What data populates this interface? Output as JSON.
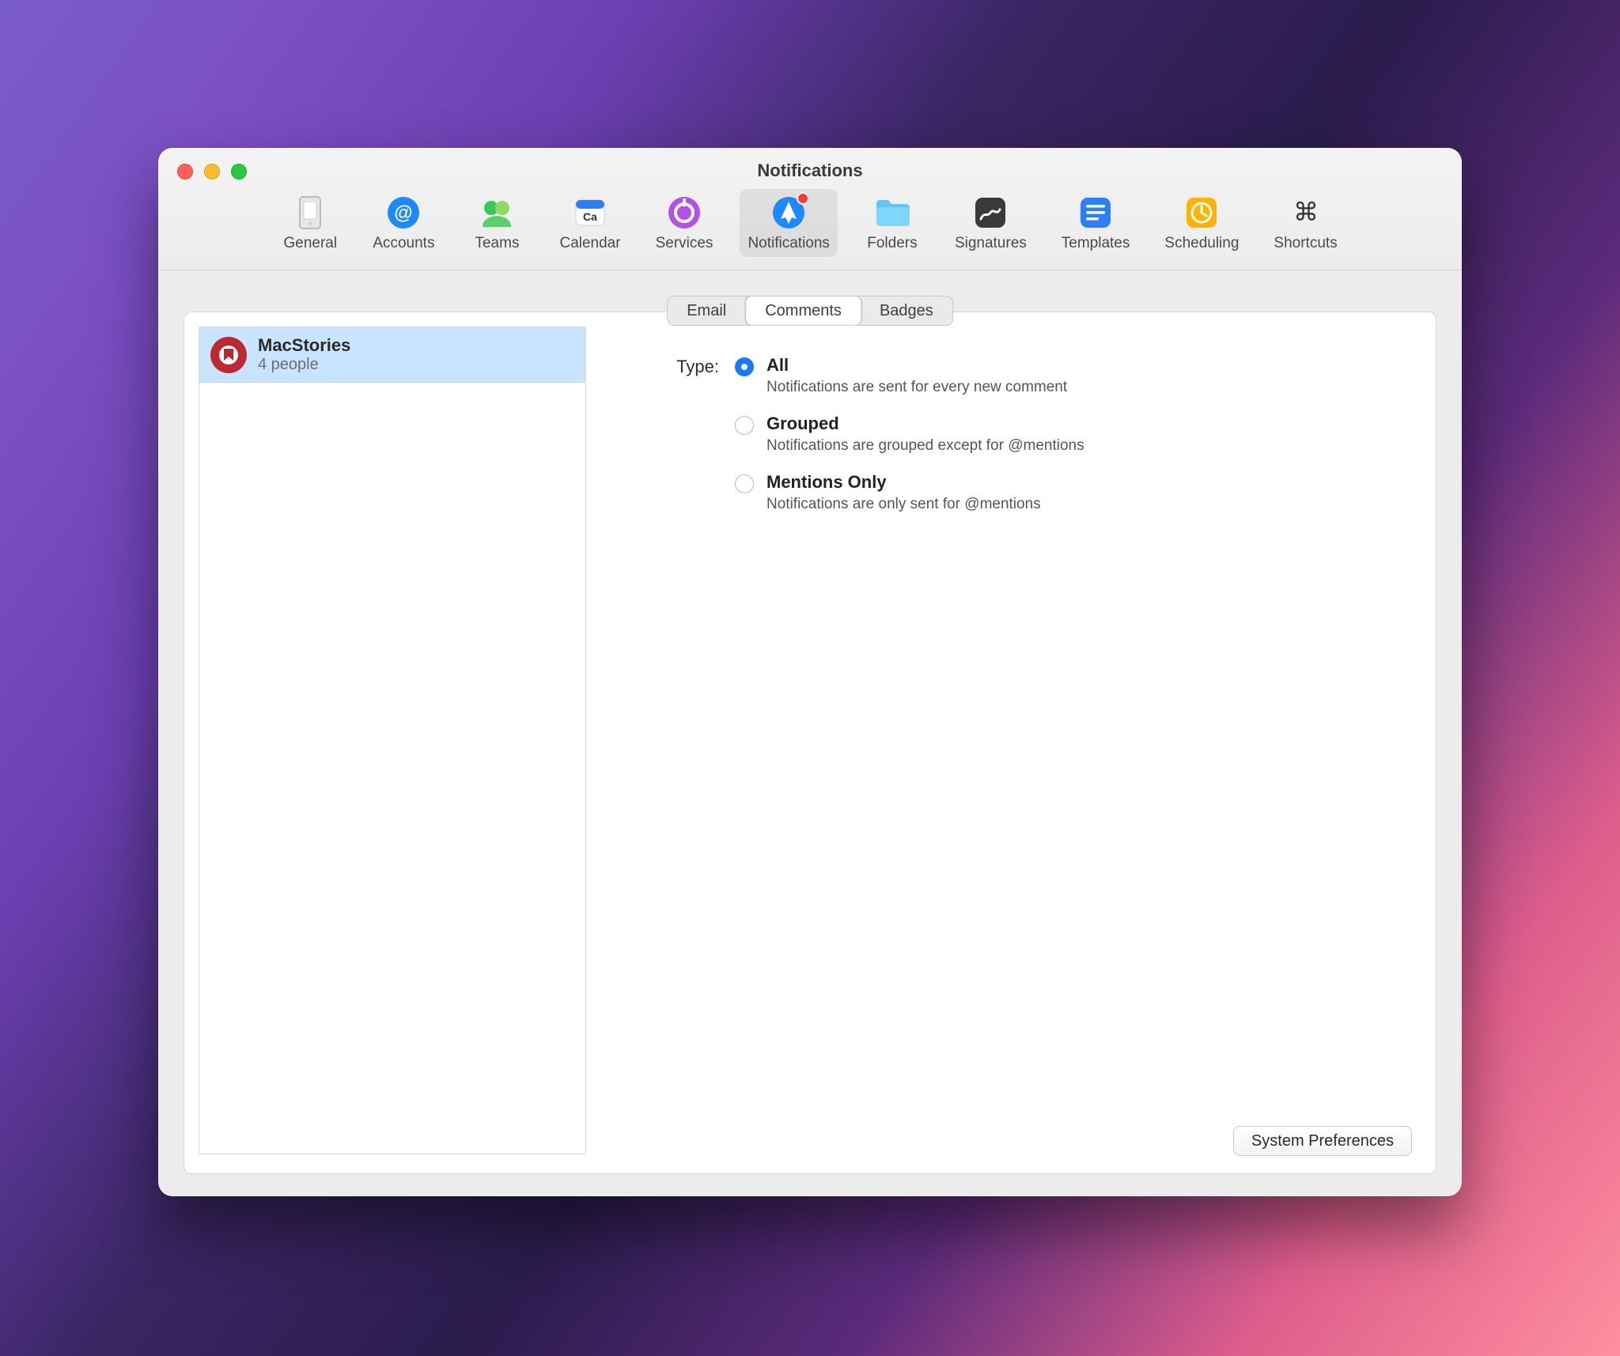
{
  "window_title": "Notifications",
  "toolbar": {
    "items": [
      {
        "id": "general",
        "label": "General"
      },
      {
        "id": "accounts",
        "label": "Accounts"
      },
      {
        "id": "teams",
        "label": "Teams"
      },
      {
        "id": "calendar",
        "label": "Calendar"
      },
      {
        "id": "services",
        "label": "Services"
      },
      {
        "id": "notifications",
        "label": "Notifications",
        "selected": true,
        "badge": true
      },
      {
        "id": "folders",
        "label": "Folders"
      },
      {
        "id": "signatures",
        "label": "Signatures"
      },
      {
        "id": "templates",
        "label": "Templates"
      },
      {
        "id": "scheduling",
        "label": "Scheduling"
      },
      {
        "id": "shortcuts",
        "label": "Shortcuts"
      }
    ]
  },
  "tabs": [
    {
      "label": "Email"
    },
    {
      "label": "Comments",
      "selected": true
    },
    {
      "label": "Badges"
    }
  ],
  "team_list": [
    {
      "name": "MacStories",
      "subtitle": "4 people",
      "selected": true
    }
  ],
  "type_section": {
    "label": "Type:",
    "options": [
      {
        "id": "all",
        "title": "All",
        "desc": "Notifications are sent for every new comment",
        "checked": true
      },
      {
        "id": "grouped",
        "title": "Grouped",
        "desc": "Notifications are grouped except for @mentions",
        "checked": false
      },
      {
        "id": "mentions",
        "title": "Mentions Only",
        "desc": "Notifications are only sent for @mentions",
        "checked": false
      }
    ]
  },
  "system_preferences_label": "System Preferences"
}
